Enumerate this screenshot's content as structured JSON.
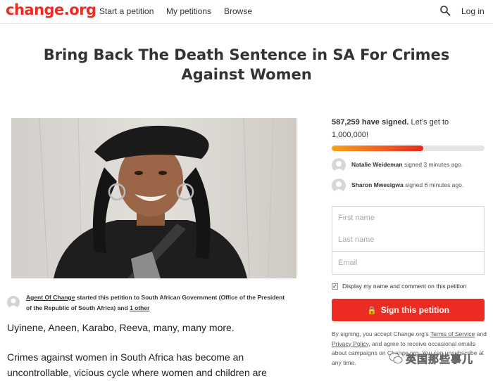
{
  "header": {
    "logo": "change.org",
    "nav": [
      "Start a petition",
      "My petitions",
      "Browse"
    ],
    "login": "Log in",
    "search_icon": "search-icon"
  },
  "petition": {
    "title": "Bring Back The Death Sentence in SA For Crimes Against Women",
    "starter_name": "Agent Of Change",
    "starter_text": "started this petition to",
    "target": "South African Government (Office of the President of the Republic of South Africa)",
    "and_text": "and",
    "other_link": "1 other",
    "paragraph1": "Uyinene, Aneen, Karabo, Reeva, many, many more.",
    "paragraph2": "Crimes against women in South Africa has become an uncontrollable, vicious cycle where women and children are"
  },
  "sidebar": {
    "signed_count": "587,259 have signed.",
    "goal_text": "Let’s get to 1,000,000!",
    "progress": 0.6,
    "signers": [
      {
        "name": "Natalie Weideman",
        "action": "signed 3 minutes ago."
      },
      {
        "name": "Sharon Mwesigwa",
        "action": "signed 6 minutes ago."
      }
    ],
    "form": {
      "first_name_placeholder": "First name",
      "last_name_placeholder": "Last name",
      "email_placeholder": "Email"
    },
    "display_checkbox": "Display my name and comment on this petition",
    "sign_button": "Sign this petition",
    "legal": {
      "prefix": "By signing, you accept Change.org's",
      "terms": "Terms of Service",
      "and": "and",
      "privacy": "Privacy Policy",
      "suffix": ", and agree to receive occasional emails about campaigns on Change.org. You can unsubscribe at any time."
    }
  },
  "watermark": "英国那些事儿",
  "colors": {
    "brand": "#ec2c22",
    "progress_start": "#f7a21b",
    "progress_end": "#e8291c"
  }
}
